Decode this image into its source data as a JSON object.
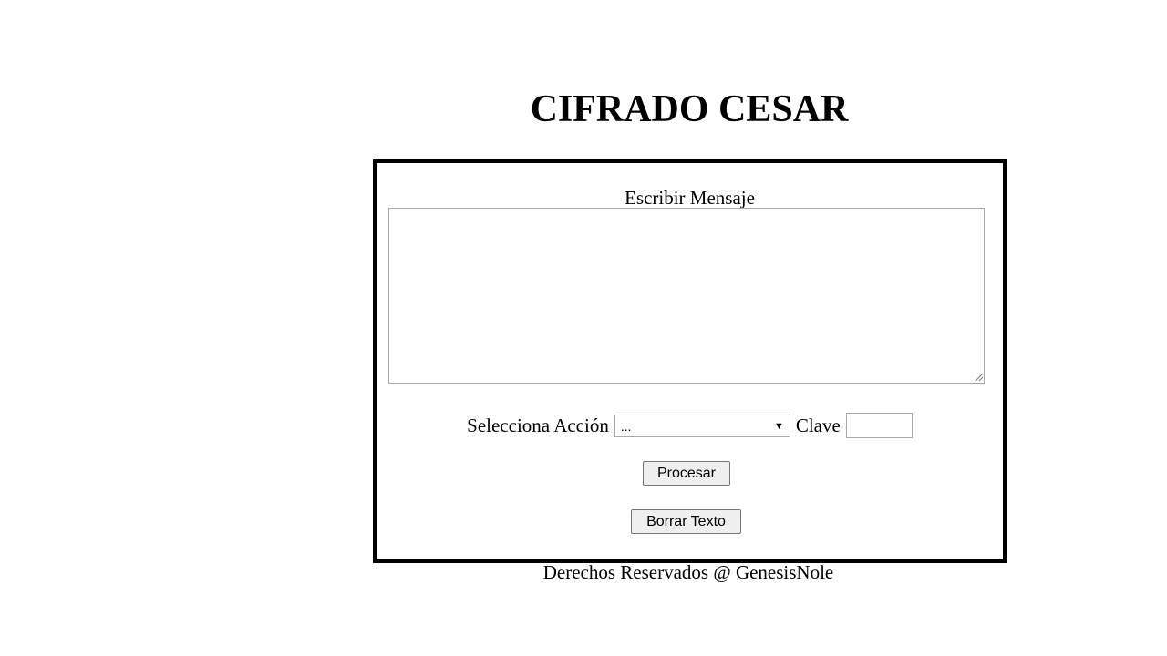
{
  "header": {
    "title": "CIFRADO CESAR"
  },
  "form": {
    "message_label": "Escribir Mensaje",
    "message_value": "",
    "action_label": "Selecciona Acción",
    "action_selected": "...",
    "key_label": "Clave",
    "key_value": "",
    "process_button": "Procesar",
    "clear_button": "Borrar Texto"
  },
  "footer": {
    "text": "Derechos Reservados @ GenesisNole"
  },
  "icons": {
    "select_arrow": "dropdown-arrow-icon",
    "resize": "resize-grip-icon"
  }
}
